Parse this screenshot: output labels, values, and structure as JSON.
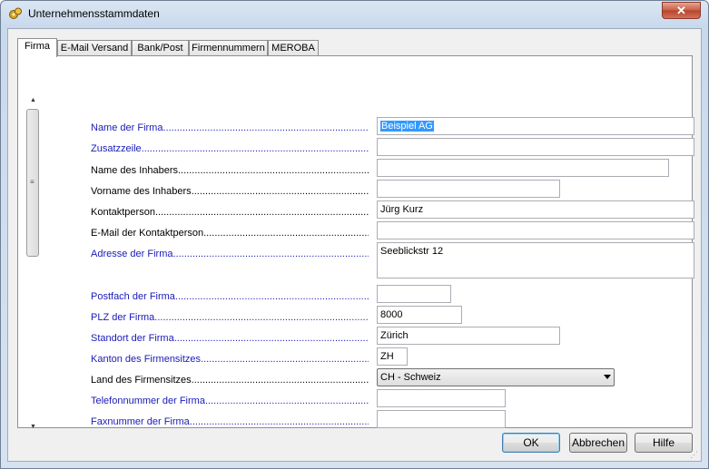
{
  "window": {
    "title": "Unternehmensstammdaten",
    "close_label": "✕"
  },
  "tabs": [
    {
      "label": "Firma"
    },
    {
      "label": "E-Mail Versand"
    },
    {
      "label": "Bank/Post"
    },
    {
      "label": "Firmennummern"
    },
    {
      "label": "MEROBA"
    }
  ],
  "scrollbar": {
    "up": "▲",
    "down": "▼",
    "grip": "≡"
  },
  "fields": [
    {
      "label": "Name der Firma",
      "value": "Beispiel AG"
    },
    {
      "label": "Zusatzzeile",
      "value": ""
    },
    {
      "label": "Name des Inhabers",
      "value": ""
    },
    {
      "label": "Vorname des Inhabers",
      "value": ""
    },
    {
      "label": "Kontaktperson",
      "value": "Jürg Kurz"
    },
    {
      "label": "E-Mail der Kontaktperson",
      "value": ""
    },
    {
      "label": "Adresse der Firma",
      "value": "Seeblickstr 12"
    },
    {
      "label": "Postfach der Firma",
      "value": ""
    },
    {
      "label": "PLZ der Firma",
      "value": "8000"
    },
    {
      "label": "Standort der Firma",
      "value": "Zürich"
    },
    {
      "label": "Kanton des Firmensitzes",
      "value": "ZH"
    },
    {
      "label": "Land des Firmensitzes",
      "value": "CH - Schweiz"
    },
    {
      "label": "Telefonnummer der Firma",
      "value": ""
    },
    {
      "label": "Faxnummer der Firma",
      "value": ""
    }
  ],
  "buttons": {
    "ok": "OK",
    "cancel": "Abbrechen",
    "help": "Hilfe"
  },
  "colors": {
    "required_label": "#1a1ab8",
    "selection": "#3399ff"
  }
}
